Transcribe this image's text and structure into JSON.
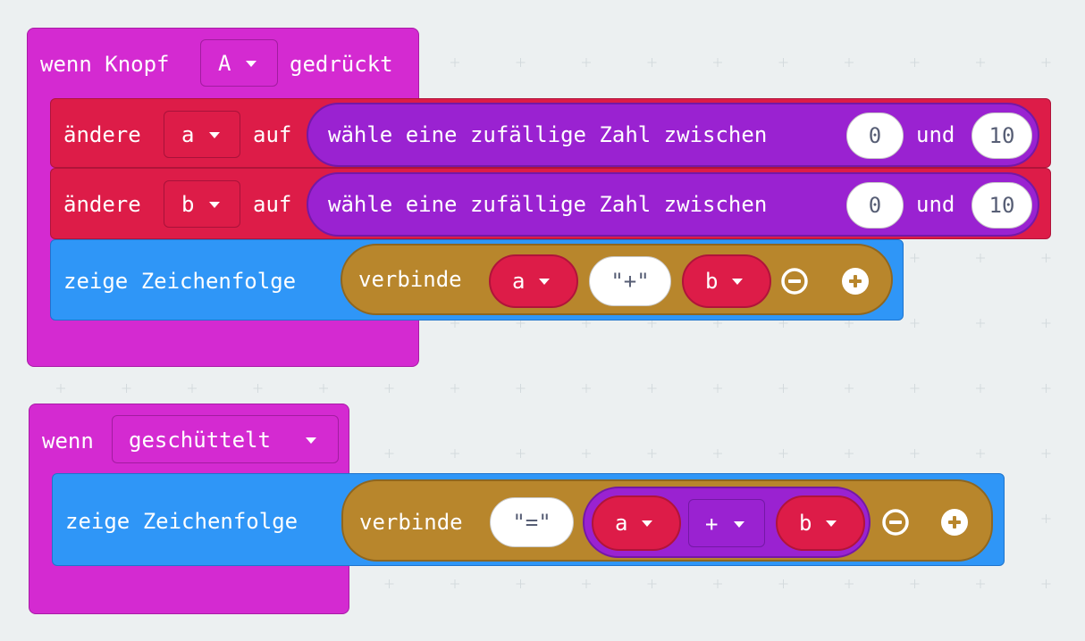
{
  "event_button": {
    "prefix": "wenn Knopf",
    "button_value": "A",
    "suffix": "gedrückt",
    "statements": [
      {
        "prefix": "ändere",
        "variable": "a",
        "mid": "auf",
        "random": {
          "label": "wähle eine zufällige Zahl zwischen",
          "from": "0",
          "and_label": "und",
          "to": "10"
        }
      },
      {
        "prefix": "ändere",
        "variable": "b",
        "mid": "auf",
        "random": {
          "label": "wähle eine zufällige Zahl zwischen",
          "from": "0",
          "and_label": "und",
          "to": "10"
        }
      }
    ],
    "show": {
      "label": "zeige Zeichenfolge",
      "join_label": "verbinde",
      "items": {
        "var1": "a",
        "string": "\"+\"",
        "var2": "b"
      }
    }
  },
  "event_shake": {
    "prefix": "wenn",
    "gesture_value": "geschüttelt",
    "show": {
      "label": "zeige Zeichenfolge",
      "join_label": "verbinde",
      "string": "\"=\"",
      "math": {
        "left": "a",
        "op": "+",
        "right": "b"
      }
    }
  },
  "colors": {
    "workspace": "#ecf0f1",
    "events": "#d42ad1",
    "variables": "#dd1c48",
    "math": "#9a22d1",
    "text": "#b8862c",
    "basic": "#2f96f7"
  }
}
